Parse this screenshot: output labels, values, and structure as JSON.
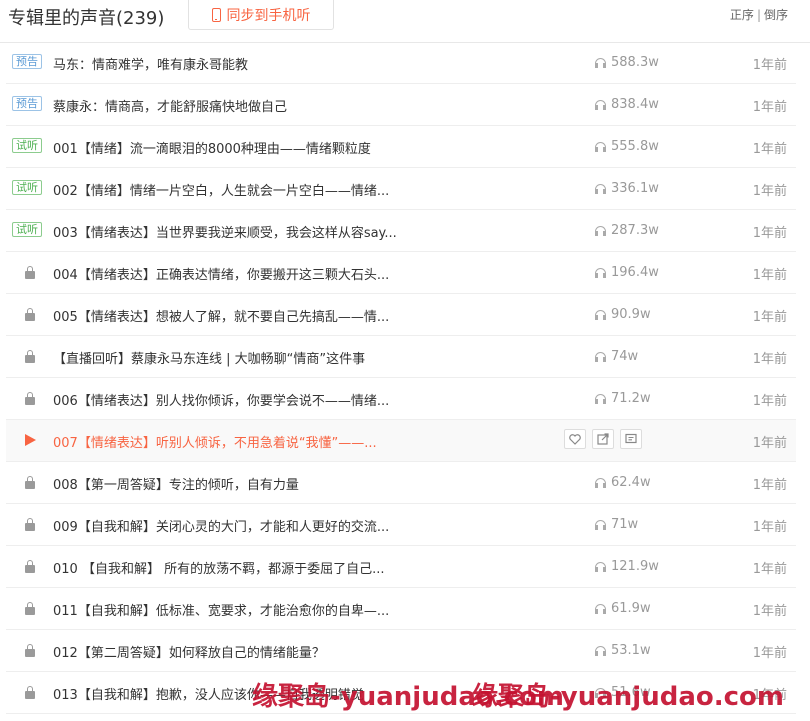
{
  "header": {
    "title": "专辑里的声音(239)",
    "sync_label": "同步到手机听",
    "sort_asc": "正序",
    "sort_sep": "|",
    "sort_desc": "倒序"
  },
  "tracks": [
    {
      "badge": "预告",
      "badge_type": "preview",
      "title": "马东：情商难学，唯有康永哥能教",
      "plays": "588.3w",
      "time": "1年前"
    },
    {
      "badge": "预告",
      "badge_type": "preview",
      "title": "蔡康永：情商高，才能舒服痛快地做自己",
      "plays": "838.4w",
      "time": "1年前"
    },
    {
      "badge": "试听",
      "badge_type": "trial",
      "title": "001【情绪】流一滴眼泪的8000种理由——情绪颗粒度",
      "plays": "555.8w",
      "time": "1年前"
    },
    {
      "badge": "试听",
      "badge_type": "trial",
      "title": "002【情绪】情绪一片空白，人生就会一片空白——情绪...",
      "plays": "336.1w",
      "time": "1年前"
    },
    {
      "badge": "试听",
      "badge_type": "trial",
      "title": "003【情绪表达】当世界要我逆来顺受，我会这样从容say...",
      "plays": "287.3w",
      "time": "1年前"
    },
    {
      "status": "locked",
      "title": "004【情绪表达】正确表达情绪，你要搬开这三颗大石头...",
      "plays": "196.4w",
      "time": "1年前"
    },
    {
      "status": "locked",
      "title": "005【情绪表达】想被人了解，就不要自己先搞乱——情...",
      "plays": "90.9w",
      "time": "1年前"
    },
    {
      "status": "locked",
      "title": "【直播回听】蔡康永马东连线 | 大咖畅聊“情商”这件事",
      "plays": "74w",
      "time": "1年前"
    },
    {
      "status": "locked",
      "title": "006【情绪表达】别人找你倾诉，你要学会说不——情绪...",
      "plays": "71.2w",
      "time": "1年前"
    },
    {
      "status": "playing",
      "title": "007【情绪表达】听别人倾诉，不用急着说“我懂”——...",
      "plays": "",
      "time": "1年前"
    },
    {
      "status": "locked",
      "title": "008【第一周答疑】专注的倾听，自有力量",
      "plays": "62.4w",
      "time": "1年前"
    },
    {
      "status": "locked",
      "title": "009【自我和解】关闭心灵的大门，才能和人更好的交流...",
      "plays": "71w",
      "time": "1年前"
    },
    {
      "status": "locked",
      "title": "010 【自我和解】 所有的放荡不羁，都源于委屈了自己...",
      "plays": "121.9w",
      "time": "1年前"
    },
    {
      "status": "locked",
      "title": "011【自我和解】低标准、宽要求，才能治愈你的自卑—...",
      "plays": "61.9w",
      "time": "1年前"
    },
    {
      "status": "locked",
      "title": "012【第二周答疑】如何释放自己的情绪能量？",
      "plays": "53.1w",
      "time": "1年前"
    },
    {
      "status": "locked",
      "title": "013【自我和解】抱歉，没人应该你——自我透明错觉",
      "plays": "51.6w",
      "time": "1年前"
    }
  ],
  "watermark": {
    "text1": "缘聚岛-yuanjudao.com",
    "text2": "缘聚岛-yuanjudao.com",
    "color": "#c41230"
  },
  "colors": {
    "accent": "#f86442",
    "preview_badge": "#5b9bd5",
    "trial_badge": "#4caf50"
  },
  "icons": {
    "sync": "phone-icon",
    "locked": "lock-icon",
    "playing": "play-icon",
    "plays": "headphones-icon",
    "actions": [
      "heart-icon",
      "share-icon",
      "comment-icon"
    ]
  }
}
